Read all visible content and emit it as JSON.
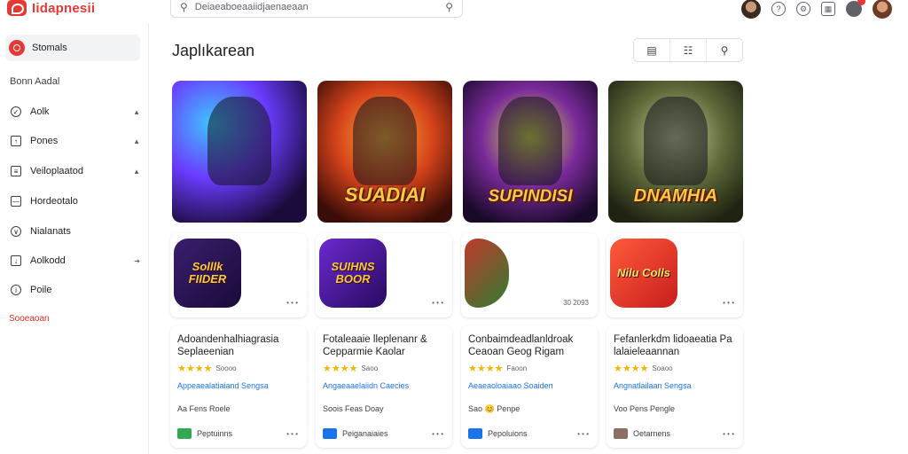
{
  "app": {
    "logo_text": "Iidapnesii"
  },
  "search": {
    "placeholder": "Deiaeaboeaaiidjaenaeaan",
    "search_icon": "search-icon",
    "mic_icon": "search-submit-icon"
  },
  "top_icons": [
    "help-icon",
    "settings-icon",
    "apps-icon",
    "notifications-icon"
  ],
  "sidebar": {
    "active_item": "Stomals",
    "section_label": "Bonn Aadal",
    "items": [
      {
        "label": "Aolk",
        "icon": "lightbulb-icon"
      },
      {
        "label": "Pones",
        "icon": "flag-icon"
      },
      {
        "label": "Veiloplaatod",
        "icon": "gamepad-icon"
      },
      {
        "label": "Hordeotalo",
        "icon": "inbox-icon"
      },
      {
        "label": "Nialanats",
        "icon": "heart-icon"
      },
      {
        "label": "Aolkodd",
        "icon": "download-icon"
      },
      {
        "label": "Poile",
        "icon": "info-icon"
      }
    ],
    "footer_link": "Sooeaoan"
  },
  "main": {
    "title": "Japlıkarean",
    "toolbar": [
      "grid-view-icon",
      "filter-icon",
      "search-icon"
    ],
    "heroes": [
      {
        "title": ""
      },
      {
        "title": "SUADIAI"
      },
      {
        "title": "SUPINDISI"
      },
      {
        "title": "DNAMHIA"
      }
    ],
    "apps": [
      {
        "icon_text": "Solllk FIIDER",
        "meta": "• • •"
      },
      {
        "icon_text": "SUIHNS BOOR",
        "meta": "• • •"
      },
      {
        "icon_text": "",
        "meta": "30 2093"
      },
      {
        "icon_text": "Nilu Colls",
        "meta": "• • •"
      }
    ],
    "cards": [
      {
        "title": "Adoandenhalhiagrasia Seplaeenian",
        "stars": "★★★★",
        "rating": "Soooo",
        "genre": "Appeaealatiaiand Sengsa",
        "dev": "Aa Fens Roele",
        "bottom": "Peptuinns",
        "bottom_color": "#34a853",
        "more": "• • •"
      },
      {
        "title": "Fotaleaaie lleplenanr & Cepparmie Kaolar",
        "stars": "★★★★",
        "rating": "Saoo",
        "genre": "Angaeaaelaiidn Caecies",
        "dev": "Soois Feas Doay",
        "bottom": "Peiganaiaies",
        "bottom_color": "#1a73e8",
        "more": "• • •"
      },
      {
        "title": "Conbaimdeadlanldroak Ceaoan Geog Rigam",
        "stars": "★★★★",
        "rating": "Faoon",
        "genre": "Aeaeaoloaiaao Soaiden",
        "dev": "Sao 😊 Penpe",
        "bottom": "Pepoluions",
        "bottom_color": "#1a73e8",
        "more": "• • •"
      },
      {
        "title": "Fefanlerkdm lidoaeatia Pa lalaieleaannan",
        "stars": "★★★★",
        "rating": "Soaoo",
        "genre": "Angnatlailaan Sengsa",
        "dev": "Voo Pens Pengle",
        "bottom": "Oetarnens",
        "bottom_color": "#8d6e63",
        "more": "• • •"
      }
    ]
  }
}
